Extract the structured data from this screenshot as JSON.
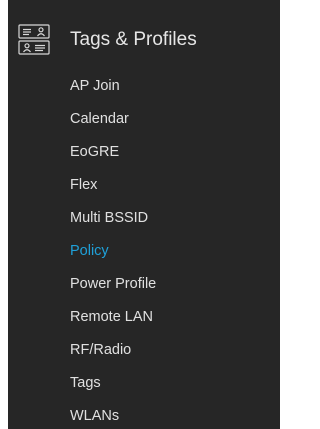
{
  "section": {
    "title": "Tags & Profiles",
    "icon": "tags-profiles-icon"
  },
  "menu": {
    "active_index": 5,
    "items": [
      {
        "label": "AP Join"
      },
      {
        "label": "Calendar"
      },
      {
        "label": "EoGRE"
      },
      {
        "label": "Flex"
      },
      {
        "label": "Multi BSSID"
      },
      {
        "label": "Policy"
      },
      {
        "label": "Power Profile"
      },
      {
        "label": "Remote LAN"
      },
      {
        "label": "RF/Radio"
      },
      {
        "label": "Tags"
      },
      {
        "label": "WLANs"
      }
    ]
  },
  "colors": {
    "panel_background": "#262626",
    "text": "#e0e0e0",
    "active": "#1fa0d8"
  }
}
